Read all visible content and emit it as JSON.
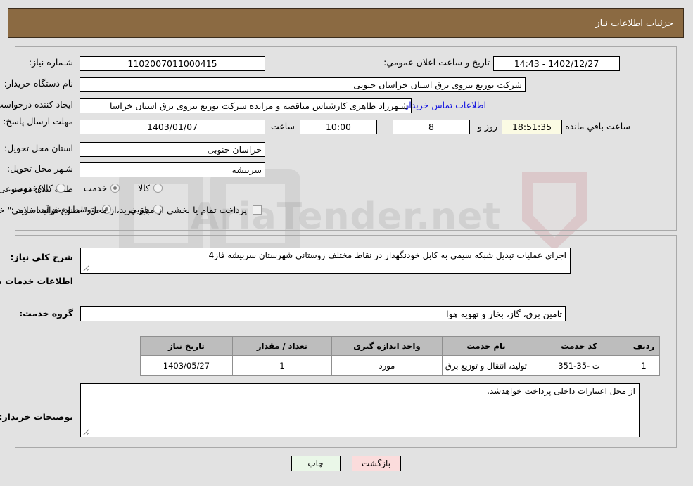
{
  "header": {
    "title": "جزئیات اطلاعات نیاز"
  },
  "watermark": {
    "text": "AriaTender.net"
  },
  "fields": {
    "need_number_label": "شـماره نیاز:",
    "need_number_value": "1102007011000415",
    "public_announce_label": "تاریخ و ساعت اعلان عمومي:",
    "public_announce_value": "1402/12/27 - 14:43",
    "buyer_org_label": "نام دستگاه خریدار:",
    "buyer_org_value": "شرکت توزیع نیروی برق استان خراسان جنوبی",
    "requester_label": "ایجاد کننده درخواست:",
    "requester_value": "شـهرزاد طاهری کارشناس مناقصه و مزایده شرکت توزیع نیروی برق استان خراسا",
    "contact_link": "اطلاعات تماس خریدار",
    "deadline_label": "مهلت ارسال پاسخ: تا تاریخ:",
    "deadline_date": "1403/01/07",
    "hour_label": "ساعت",
    "deadline_time": "10:00",
    "days_value": "8",
    "days_label": "روز و",
    "countdown_value": "18:51:35",
    "remaining_label": "ساعت باقي مانده",
    "province_label": "استان محل تحویل:",
    "province_value": "خراسان جنوبی",
    "city_label": "شـهر محل تحویل:",
    "city_value": "سربیشه",
    "category_label": "طبقه بندی موضوعی:",
    "category_options": [
      {
        "label": "کالا",
        "selected": false
      },
      {
        "label": "خدمت",
        "selected": true
      },
      {
        "label": "کالا/خدمت",
        "selected": false
      }
    ],
    "process_label": "نوع فرآیند خرید :",
    "process_options": [
      {
        "label": "جزیي",
        "selected": false
      },
      {
        "label": "متوسط",
        "selected": true
      }
    ],
    "treasury_checkbox_checked": false,
    "treasury_text": "پرداخت تمام یا بخشی از مبلغ خرید،از محل \"اسناد خزانه اسلامی\" خواهد بود."
  },
  "body": {
    "summary_label": "شرح کلي نیاز:",
    "summary_value": "اجرای عملیات تبدیل شبکه سیمی به کابل خودنگهدار در نقاط مختلف زوستانی شهرستان سربیشه فاز4",
    "services_heading": "اطلاعات خدمات مورد نیاز",
    "service_group_label": "گروه خدمت:",
    "service_group_value": "تامین برق، گاز، بخار و تهویه هوا",
    "buyer_notes_label": "توضیحات خریدار:",
    "buyer_notes_value": "از محل اعتبارات داخلی پرداخت خواهدشد."
  },
  "table": {
    "headers": [
      "ردیف",
      "کد خدمت",
      "نام خدمت",
      "واحد اندازه گیری",
      "تعداد / مقدار",
      "تاریخ نیاز"
    ],
    "rows": [
      {
        "row": "1",
        "code": "ت -35-351",
        "name": "تولید، انتقال و توزیع برق",
        "unit": "مورد",
        "qty": "1",
        "date": "1403/05/27"
      }
    ]
  },
  "buttons": {
    "print": "چاپ",
    "back": "بازگشت"
  },
  "colors": {
    "header_bg": "#8b6a42",
    "page_bg": "#e2e2e2",
    "link": "#1414e0",
    "countdown_bg": "#fbfbe4",
    "table_header_bg": "#bdbdbd",
    "btn_print_bg": "#eaf7e8",
    "btn_back_bg": "#fbdcdc"
  }
}
